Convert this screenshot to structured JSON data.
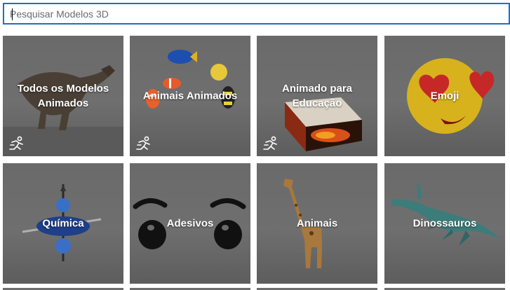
{
  "search": {
    "placeholder": "Pesquisar Modelos 3D",
    "value": ""
  },
  "categories": [
    {
      "label": "Todos os Modelos Animados",
      "animated_badge": true,
      "icon": "running-person-icon"
    },
    {
      "label": "Animais Animados",
      "animated_badge": true,
      "icon": "running-person-icon"
    },
    {
      "label": "Animado para Educação",
      "animated_badge": true,
      "icon": "running-person-icon"
    },
    {
      "label": "Emoji",
      "animated_badge": false
    },
    {
      "label": "Química",
      "animated_badge": false
    },
    {
      "label": "Adesivos",
      "animated_badge": false
    },
    {
      "label": "Animais",
      "animated_badge": false
    },
    {
      "label": "Dinossauros",
      "animated_badge": false
    }
  ],
  "colors": {
    "focus_border": "#1f6fbf",
    "tile_background": "#6a6a6a",
    "label_text": "#ffffff"
  }
}
